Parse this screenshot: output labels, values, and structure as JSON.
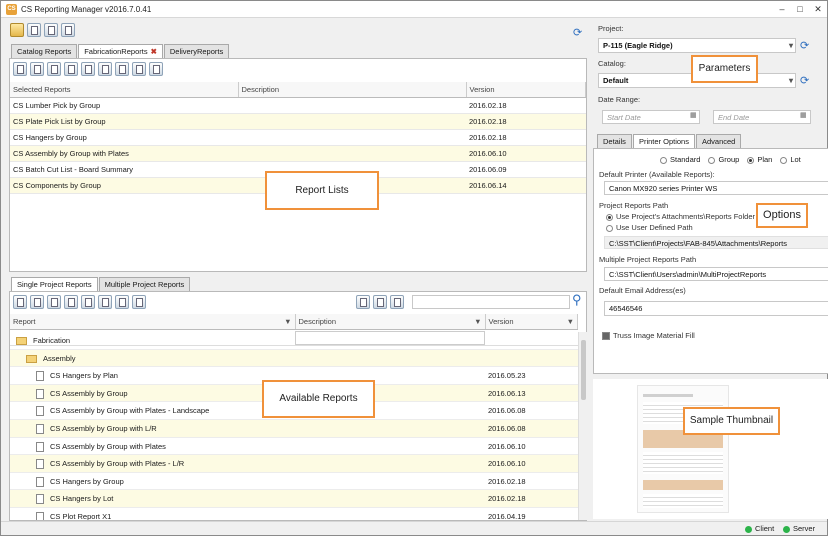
{
  "window": {
    "title": "CS Reporting Manager v2016.7.0.41",
    "app_icon_text": "CS"
  },
  "catalog_tabs": [
    {
      "label": "Catalog Reports",
      "active": false
    },
    {
      "label": "FabricationReports",
      "active": true
    },
    {
      "label": "DeliveryReports",
      "active": false
    }
  ],
  "selected_reports": {
    "columns": [
      "Selected Reports",
      "Description",
      "Version"
    ],
    "rows": [
      [
        "CS Lumber Pick by Group",
        "",
        "2016.02.18"
      ],
      [
        "CS Plate Pick List by Group",
        "",
        "2016.02.18"
      ],
      [
        "CS Hangers by Group",
        "",
        "2016.02.18"
      ],
      [
        "CS Assembly by Group with Plates",
        "",
        "2016.06.10"
      ],
      [
        "CS Batch Cut List - Board Summary",
        "",
        "2016.06.09"
      ],
      [
        "CS Components by Group",
        "",
        "2016.06.14"
      ]
    ]
  },
  "project_tabs": [
    {
      "label": "Single Project Reports",
      "active": true
    },
    {
      "label": "Multiple Project Reports",
      "active": false
    }
  ],
  "available_reports": {
    "columns": [
      "Report",
      "Description",
      "Version"
    ],
    "rows": [
      {
        "kind": "folder",
        "level": 0,
        "name": "Fabrication",
        "version": ""
      },
      {
        "kind": "folder",
        "level": 1,
        "name": "Assembly",
        "version": ""
      },
      {
        "kind": "report",
        "level": 2,
        "name": "CS Hangers by Plan",
        "version": "2016.05.23"
      },
      {
        "kind": "report",
        "level": 2,
        "name": "CS Assembly by Group",
        "version": "2016.06.13"
      },
      {
        "kind": "report",
        "level": 2,
        "name": "CS Assembly by Group with Plates - Landscape",
        "version": "2016.06.08"
      },
      {
        "kind": "report",
        "level": 2,
        "name": "CS Assembly by Group with L/R",
        "version": "2016.06.08"
      },
      {
        "kind": "report",
        "level": 2,
        "name": "CS Assembly by Group with Plates",
        "version": "2016.06.10"
      },
      {
        "kind": "report",
        "level": 2,
        "name": "CS Assembly by Group with Plates - L/R",
        "version": "2016.06.10"
      },
      {
        "kind": "report",
        "level": 2,
        "name": "CS Hangers by Group",
        "version": "2016.02.18"
      },
      {
        "kind": "report",
        "level": 2,
        "name": "CS Hangers by Lot",
        "version": "2016.02.18"
      },
      {
        "kind": "report",
        "level": 2,
        "name": "CS Plot Report X1",
        "version": "2016.04.19"
      }
    ]
  },
  "parameters": {
    "project_label": "Project:",
    "project_value": "P-115 (Eagle Ridge)",
    "catalog_label": "Catalog:",
    "catalog_value": "Default",
    "date_range_label": "Date Range:",
    "start_placeholder": "Start Date",
    "end_placeholder": "End Date"
  },
  "options_tabs": [
    {
      "label": "Details",
      "active": false
    },
    {
      "label": "Printer Options",
      "active": true
    },
    {
      "label": "Advanced",
      "active": false
    }
  ],
  "printer_options": {
    "radios": [
      {
        "label": "Standard",
        "checked": false
      },
      {
        "label": "Group",
        "checked": false
      },
      {
        "label": "Plan",
        "checked": true
      },
      {
        "label": "Lot",
        "checked": false
      }
    ],
    "default_printer_label": "Default Printer (Available Reports):",
    "default_printer_value": "Canon MX920 series Printer WS",
    "project_path_label": "Project Reports Path",
    "path_option_1": "Use Project's Attachments\\Reports Folder",
    "path_option_2": "Use User Defined Path",
    "project_path_value": "C:\\SST\\Client\\Projects\\FAB-845\\Attachments\\Reports",
    "multi_path_label": "Multiple Project Reports Path",
    "multi_path_value": "C:\\SST\\Client\\Users\\admin\\MultiProjectReports",
    "email_label": "Default Email Address(es)",
    "email_value": "46546546",
    "truss_label": "Truss Image Material Fill"
  },
  "callouts": {
    "report_lists": "Report Lists",
    "available_reports": "Available Reports",
    "parameters": "Parameters",
    "options": "Options",
    "sample_thumbnail": "Sample Thumbnail"
  },
  "status": {
    "client": "Client",
    "server": "Server",
    "ok_color": "#2cb34a"
  },
  "accent_color": "#f0913a"
}
